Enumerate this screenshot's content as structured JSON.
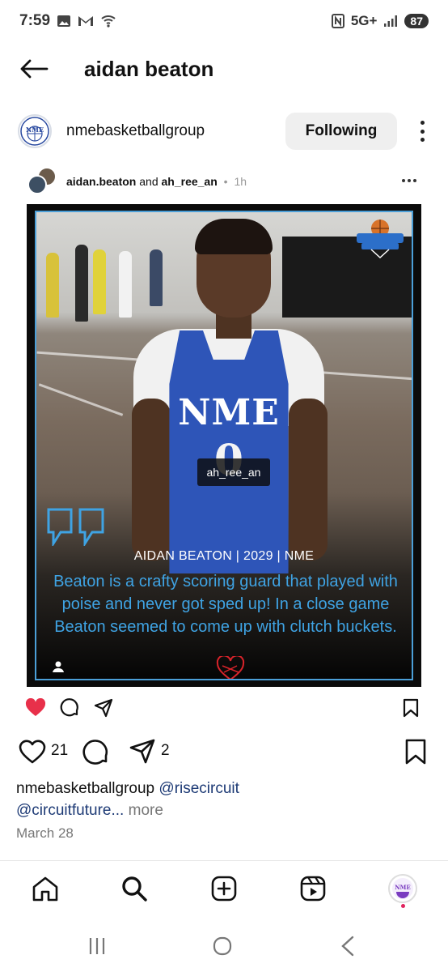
{
  "status_bar": {
    "time": "7:59",
    "network": "5G+",
    "battery": "87",
    "left_icons": [
      "gallery-icon",
      "gmail-icon",
      "wifi-icon"
    ],
    "right_icons": [
      "nfc-icon",
      "signal-icon"
    ]
  },
  "header": {
    "title": "aidan beaton",
    "back_icon": "back-arrow-icon"
  },
  "account": {
    "username": "nmebasketballgroup",
    "avatar_text": "NME",
    "follow_label": "Following"
  },
  "embedded_post": {
    "author_primary": "aidan.beaton",
    "connector": " and ",
    "author_secondary": "ah_ree_an",
    "separator": " • ",
    "time": "1h"
  },
  "photo": {
    "jersey_text": "NME",
    "jersey_number": "0",
    "tag": "ah_ree_an",
    "caption_name": "AIDAN BEATON | 2029 | NME",
    "caption_body": "Beaton is a crafty scoring guard that played with poise and never got sped up! In a close game Beaton seemed to come up with clutch buckets.",
    "colors": {
      "caption_blue": "#3fa3e3",
      "jersey_blue": "#2e55b8",
      "frame_blue": "#4b9fd8"
    }
  },
  "embedded_actions": {
    "liked": true,
    "like_color": "#e8304a"
  },
  "actions": {
    "likes": "21",
    "shares": "2"
  },
  "caption": {
    "username": "nmebasketballgroup",
    "mention_1": "@risecircuit",
    "mention_2": "@circuitfuture",
    "ellipsis": "...",
    "more": "more"
  },
  "date": "March 28",
  "bottom_nav": {
    "items": [
      "home-icon",
      "search-icon",
      "create-icon",
      "reels-icon",
      "profile-avatar"
    ],
    "profile_text": "NME"
  },
  "system_nav": [
    "recents-icon",
    "home-circle-icon",
    "back-chevron-icon"
  ]
}
